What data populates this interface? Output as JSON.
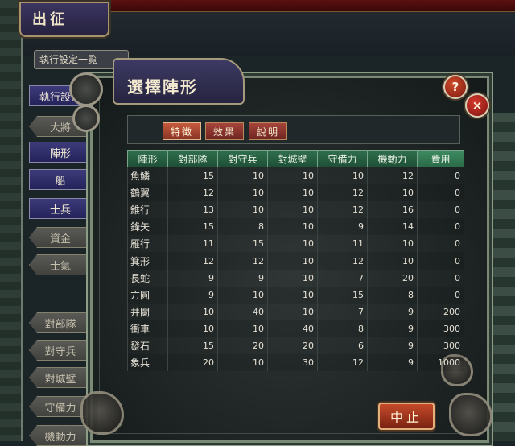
{
  "screen": {
    "title": "出征",
    "exec_label": "執行設定一覧"
  },
  "sidebar": {
    "items": [
      {
        "label": "執行設定",
        "style": "blue"
      },
      {
        "label": "大將",
        "style": "grey"
      },
      {
        "label": "陣形",
        "style": "blue"
      },
      {
        "label": "船",
        "style": "blue"
      },
      {
        "label": "士兵",
        "style": "blue"
      },
      {
        "label": "資金",
        "style": "grey"
      },
      {
        "label": "士氣",
        "style": "grey"
      },
      {
        "label": "對部隊",
        "style": "grey"
      },
      {
        "label": "對守兵",
        "style": "grey"
      },
      {
        "label": "對城壁",
        "style": "grey"
      },
      {
        "label": "守備力",
        "style": "grey"
      },
      {
        "label": "機動力",
        "style": "grey"
      }
    ]
  },
  "dialog": {
    "title": "選擇陣形",
    "help_icon": "?",
    "close_icon": "×",
    "tabs": [
      {
        "label": "特徵",
        "active": true
      },
      {
        "label": "效果",
        "active": false
      },
      {
        "label": "說明",
        "active": false
      }
    ],
    "columns": [
      "陣形",
      "對部隊",
      "對守兵",
      "對城壁",
      "守備力",
      "機動力",
      "費用"
    ],
    "rows": [
      [
        "魚鱗",
        "15",
        "10",
        "10",
        "10",
        "12",
        "0"
      ],
      [
        "鶴翼",
        "12",
        "10",
        "10",
        "12",
        "10",
        "0"
      ],
      [
        "錐行",
        "13",
        "10",
        "10",
        "12",
        "16",
        "0"
      ],
      [
        "鋒矢",
        "15",
        "8",
        "10",
        "9",
        "14",
        "0"
      ],
      [
        "雁行",
        "11",
        "15",
        "10",
        "11",
        "10",
        "0"
      ],
      [
        "箕形",
        "12",
        "12",
        "10",
        "12",
        "10",
        "0"
      ],
      [
        "長蛇",
        "9",
        "9",
        "10",
        "7",
        "20",
        "0"
      ],
      [
        "方圓",
        "9",
        "10",
        "10",
        "15",
        "8",
        "0"
      ],
      [
        "井闌",
        "10",
        "40",
        "10",
        "7",
        "9",
        "200"
      ],
      [
        "衝車",
        "10",
        "10",
        "40",
        "8",
        "9",
        "300"
      ],
      [
        "發石",
        "15",
        "20",
        "20",
        "6",
        "9",
        "300"
      ],
      [
        "象兵",
        "20",
        "10",
        "30",
        "12",
        "9",
        "1000"
      ]
    ],
    "stop_label": "中止"
  },
  "colors": {
    "header_green": "#2f6e4c",
    "tab_red": "#a6453a",
    "button_red": "#c54a2a",
    "panel_blue": "#3d3a7a"
  }
}
